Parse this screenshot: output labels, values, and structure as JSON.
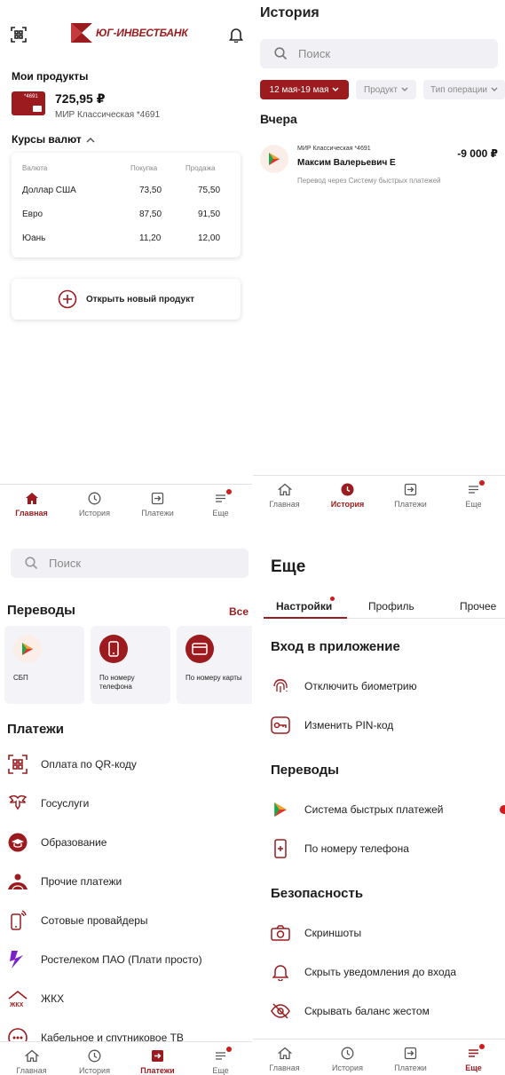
{
  "colors": {
    "brand": "#9b1b1e",
    "accent_red": "#d11b1e",
    "muted": "#8a8a8a",
    "card_bg": "#f4f4f8"
  },
  "home": {
    "logo_text": "ЮГ-ИНВЕСТБАНК",
    "products_title": "Мои продукты",
    "card_label": "*4691",
    "balance": "725,95 ₽",
    "card_name": "МИР Классическая *4691",
    "rates_title": "Курсы валют",
    "rates": {
      "headers": [
        "Валюта",
        "Покупка",
        "Продажа"
      ],
      "rows": [
        {
          "currency": "Доллар США",
          "buy": "73,50",
          "sell": "75,50"
        },
        {
          "currency": "Евро",
          "buy": "87,50",
          "sell": "91,50"
        },
        {
          "currency": "Юань",
          "buy": "11,20",
          "sell": "12,00"
        }
      ]
    },
    "open_product": "Открыть новый продукт"
  },
  "nav": {
    "home": "Главная",
    "history": "История",
    "payments": "Платежи",
    "more": "Еще"
  },
  "history": {
    "title": "История",
    "search_placeholder": "Поиск",
    "filters": {
      "date": "12 мая-19 мая",
      "product": "Продукт",
      "operation_type": "Тип операции"
    },
    "group_title": "Вчера",
    "transaction": {
      "card": "МИР Классическая *4691",
      "name": "Максим Валерьевич Е",
      "amount": "-9 000 ₽",
      "description": "Перевод через Систему быстрых платежей"
    }
  },
  "payments": {
    "search_placeholder": "Поиск",
    "transfers_title": "Переводы",
    "transfers_all": "Все",
    "transfers": [
      "СБП",
      "По номеру телефона",
      "По номеру карты"
    ],
    "payments_title": "Платежи",
    "items": [
      {
        "label": "Оплата по QR-коду",
        "icon": "qr-code-icon"
      },
      {
        "label": "Госуслуги",
        "icon": "gosuslugi-eagle-icon"
      },
      {
        "label": "Образование",
        "icon": "graduation-cap-icon"
      },
      {
        "label": "Прочие платежи",
        "icon": "hands-coins-icon"
      },
      {
        "label": "Сотовые провайдеры",
        "icon": "mobile-phone-icon"
      },
      {
        "label": "Ростелеком ПАО (Плати просто)",
        "icon": "rostelecom-icon"
      },
      {
        "label": "ЖКХ",
        "icon": "house-icon"
      },
      {
        "label": "Кабельное и спутниковое ТВ",
        "icon": "tv-icon"
      }
    ]
  },
  "more": {
    "title": "Еще",
    "tabs": [
      "Настройки",
      "Профиль",
      "Прочее"
    ],
    "login_title": "Вход в приложение",
    "login_items": [
      "Отключить биометрию",
      "Изменить PIN-код"
    ],
    "transfers_title": "Переводы",
    "transfers_items": [
      "Система быстрых платежей",
      "По номеру телефона"
    ],
    "security_title": "Безопасность",
    "security_items": [
      "Скриншоты",
      "Скрыть уведомления до входа",
      "Скрывать баланс жестом"
    ]
  }
}
